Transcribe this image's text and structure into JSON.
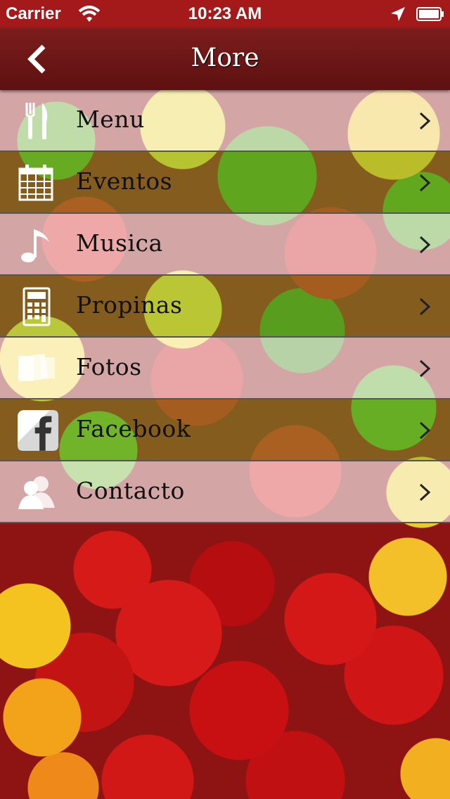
{
  "status_bar": {
    "carrier": "Carrier",
    "time": "10:23 AM"
  },
  "nav": {
    "title": "More"
  },
  "menu": {
    "items": [
      {
        "label": "Menu",
        "icon": "fork-knife-icon"
      },
      {
        "label": "Eventos",
        "icon": "calendar-icon"
      },
      {
        "label": "Musica",
        "icon": "music-note-icon"
      },
      {
        "label": "Propinas",
        "icon": "calculator-icon"
      },
      {
        "label": "Fotos",
        "icon": "photos-icon"
      },
      {
        "label": "Facebook",
        "icon": "facebook-icon"
      },
      {
        "label": "Contacto",
        "icon": "contacts-icon"
      }
    ]
  },
  "colors": {
    "status_bar": "#a41a1a",
    "nav_bar": "#6b1616"
  }
}
